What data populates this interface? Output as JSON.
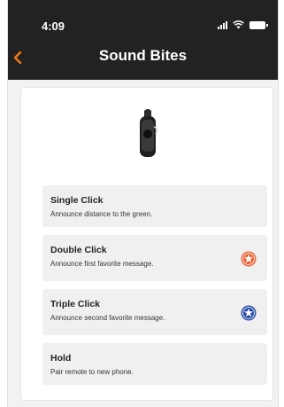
{
  "status_bar": {
    "time": "4:09"
  },
  "header": {
    "title": "Sound Bites",
    "back_icon": "chevron-left-icon",
    "accent": "#f07a1a"
  },
  "items": [
    {
      "title": "Single Click",
      "desc": "Announce distance to the green."
    },
    {
      "title": "Double Click",
      "desc": "Announce first favorite message.",
      "icon": "star-badge-orange-icon",
      "icon_color": "#e8663a"
    },
    {
      "title": "Triple Click",
      "desc": "Announce second favorite message.",
      "icon": "star-badge-blue-icon",
      "icon_color": "#2b4fa8"
    },
    {
      "title": "Hold",
      "desc": "Pair remote to new phone."
    }
  ]
}
